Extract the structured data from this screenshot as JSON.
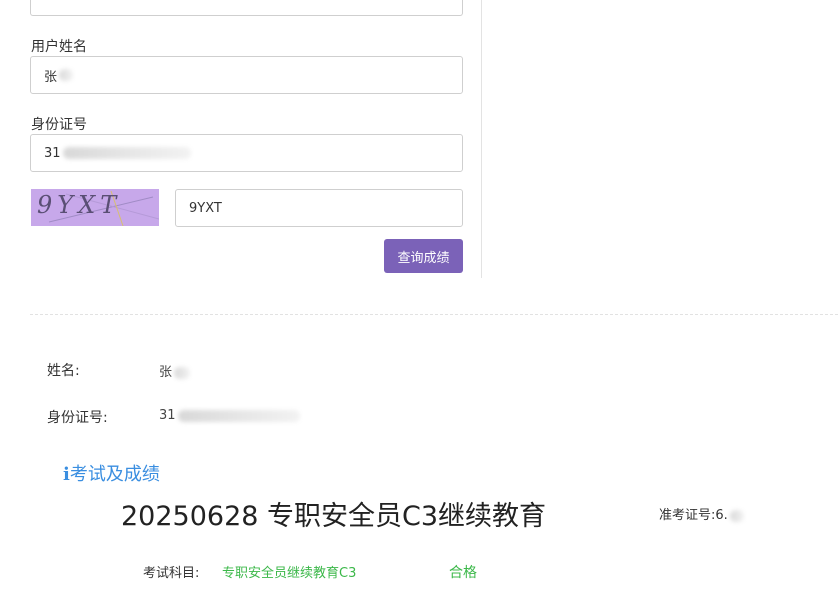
{
  "form": {
    "name_label": "用户姓名",
    "name_value": "张",
    "id_label": "身份证号",
    "id_value": "31",
    "captcha_image_text": "9YXT",
    "captcha_input_value": "9YXT",
    "submit_label": "查询成绩"
  },
  "result": {
    "name_label": "姓名:",
    "name_value": "张",
    "id_label": "身份证号:",
    "id_value": "31",
    "section_icon": "info-icon",
    "section_title": "考试及成绩",
    "exam_title": "20250628 专职安全员C3继续教育",
    "admission_label": "准考证号:",
    "admission_value": "6.",
    "subject_label": "考试科目:",
    "subject_value": "专职安全员继续教育C3",
    "status": "合格"
  },
  "colors": {
    "button": "#7b62b8",
    "captcha_bg": "#c7a8ea",
    "section_title": "#3a8ee0",
    "pass_green": "#3cb84a"
  }
}
